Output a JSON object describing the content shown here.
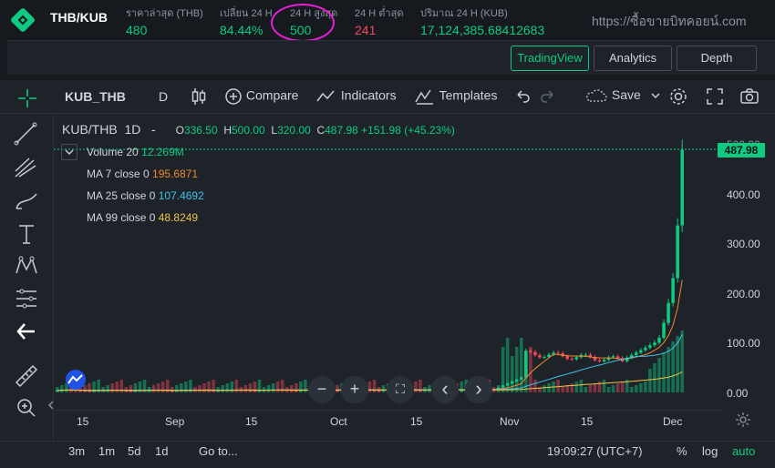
{
  "ticker": {
    "pair": "THB/KUB",
    "stats": [
      {
        "label": "ราคาล่าสุด (THB)",
        "value": "480",
        "color": "green"
      },
      {
        "label": "เปลี่ยน 24 H",
        "value": "84.44%",
        "color": "green"
      },
      {
        "label": "24 H สูงสุด",
        "value": "500",
        "color": "green"
      },
      {
        "label": "24 H ต่ำสุด",
        "value": "241",
        "color": "red"
      },
      {
        "label": "ปริมาณ 24 H (KUB)",
        "value": "17,124,385.68412683",
        "color": "green"
      }
    ],
    "watermark": "https://ซื้อขายบิทคอยน์.com"
  },
  "view_tabs": [
    "TradingView",
    "Analytics",
    "Depth"
  ],
  "toolbar": {
    "symbol": "KUB_THB",
    "interval": "D",
    "compare": "Compare",
    "indicators": "Indicators",
    "templates": "Templates",
    "save": "Save"
  },
  "chart_header": {
    "symbol": "KUB/THB",
    "interval": "1D",
    "sep": "-",
    "o_lbl": "O",
    "o": "336.50",
    "h_lbl": "H",
    "h": "500.00",
    "l_lbl": "L",
    "l": "320.00",
    "c_lbl": "C",
    "c": "487.98",
    "change": "+151.98 (+45.23%)"
  },
  "legend": [
    {
      "label": "Volume 20",
      "value": "12.269M",
      "color": "#0ecb81"
    },
    {
      "label": "MA 7 close 0",
      "value": "195.6871",
      "color": "#f0882a"
    },
    {
      "label": "MA 25 close 0",
      "value": "107.4692",
      "color": "#3ec3e8"
    },
    {
      "label": "MA 99 close 0",
      "value": "48.8249",
      "color": "#f0c54a"
    }
  ],
  "chart_data": {
    "type": "candlestick",
    "last_price": "487.98",
    "ylim": [
      -30,
      520
    ],
    "y_ticks": [
      "500.00",
      "400.00",
      "300.00",
      "200.00",
      "100.00",
      "0.00"
    ],
    "x_ticks": [
      "15",
      "Sep",
      "15",
      "Oct",
      "15",
      "Nov",
      "15",
      "Dec"
    ],
    "colors": {
      "up": "#0ecb81",
      "down": "#f6465d"
    }
  },
  "chart_buttons": {
    "zoom_out": "−",
    "zoom_in": "+",
    "reset": "⛶",
    "left": "‹",
    "right": "›"
  },
  "bottom": {
    "ranges": [
      "3m",
      "1m",
      "5d",
      "1d"
    ],
    "goto": "Go to...",
    "clock": "19:09:27 (UTC+7)",
    "pct": "%",
    "log": "log",
    "auto": "auto"
  }
}
